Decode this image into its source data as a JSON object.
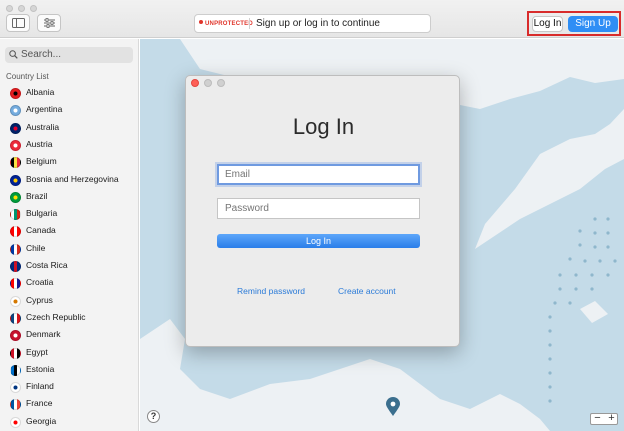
{
  "toolbar": {
    "status_badge": "UNPROTECTED",
    "status_message": "Sign up or log in to continue",
    "login_label": "Log In",
    "signup_label": "Sign Up"
  },
  "sidebar": {
    "search_placeholder": "Search...",
    "list_header": "Country List",
    "countries": [
      {
        "name": "Albania",
        "flag": [
          "#e41e20",
          "#000000"
        ]
      },
      {
        "name": "Argentina",
        "flag": [
          "#74acdf",
          "#ffffff"
        ]
      },
      {
        "name": "Australia",
        "flag": [
          "#012169",
          "#e4002b"
        ]
      },
      {
        "name": "Austria",
        "flag": [
          "#ed2939",
          "#ffffff"
        ]
      },
      {
        "name": "Belgium",
        "flag": [
          "#000000",
          "#fae042",
          "#ed2939"
        ]
      },
      {
        "name": "Bosnia and Herzegovina",
        "flag": [
          "#002395",
          "#fecb00"
        ]
      },
      {
        "name": "Brazil",
        "flag": [
          "#009c3b",
          "#ffdf00"
        ]
      },
      {
        "name": "Bulgaria",
        "flag": [
          "#ffffff",
          "#00966e",
          "#d62612"
        ]
      },
      {
        "name": "Canada",
        "flag": [
          "#ff0000",
          "#ffffff",
          "#ff0000"
        ]
      },
      {
        "name": "Chile",
        "flag": [
          "#0039a6",
          "#ffffff",
          "#d52b1e"
        ]
      },
      {
        "name": "Costa Rica",
        "flag": [
          "#002b7f",
          "#ce1126",
          "#002b7f"
        ]
      },
      {
        "name": "Croatia",
        "flag": [
          "#ff0000",
          "#ffffff",
          "#171796"
        ]
      },
      {
        "name": "Cyprus",
        "flag": [
          "#ffffff",
          "#d57800"
        ]
      },
      {
        "name": "Czech Republic",
        "flag": [
          "#11457e",
          "#ffffff",
          "#d7141a"
        ]
      },
      {
        "name": "Denmark",
        "flag": [
          "#c8102e",
          "#ffffff"
        ]
      },
      {
        "name": "Egypt",
        "flag": [
          "#ce1126",
          "#ffffff",
          "#000000"
        ]
      },
      {
        "name": "Estonia",
        "flag": [
          "#0072ce",
          "#000000",
          "#ffffff"
        ]
      },
      {
        "name": "Finland",
        "flag": [
          "#ffffff",
          "#003580"
        ]
      },
      {
        "name": "France",
        "flag": [
          "#0055a4",
          "#ffffff",
          "#ef4135"
        ]
      },
      {
        "name": "Georgia",
        "flag": [
          "#ffffff",
          "#ff0000"
        ]
      }
    ]
  },
  "dialog": {
    "title": "Log In",
    "email_placeholder": "Email",
    "password_placeholder": "Password",
    "login_button": "Log In",
    "remind_password": "Remind password",
    "create_account": "Create account"
  },
  "map": {
    "help_label": "?",
    "zoom_out": "−",
    "zoom_in": "+"
  },
  "colors": {
    "accent": "#2f8ef5",
    "danger": "#e0352b",
    "map_water": "#c4dbe8",
    "map_land": "#edf1f4",
    "highlight_box": "#d82b2b"
  }
}
